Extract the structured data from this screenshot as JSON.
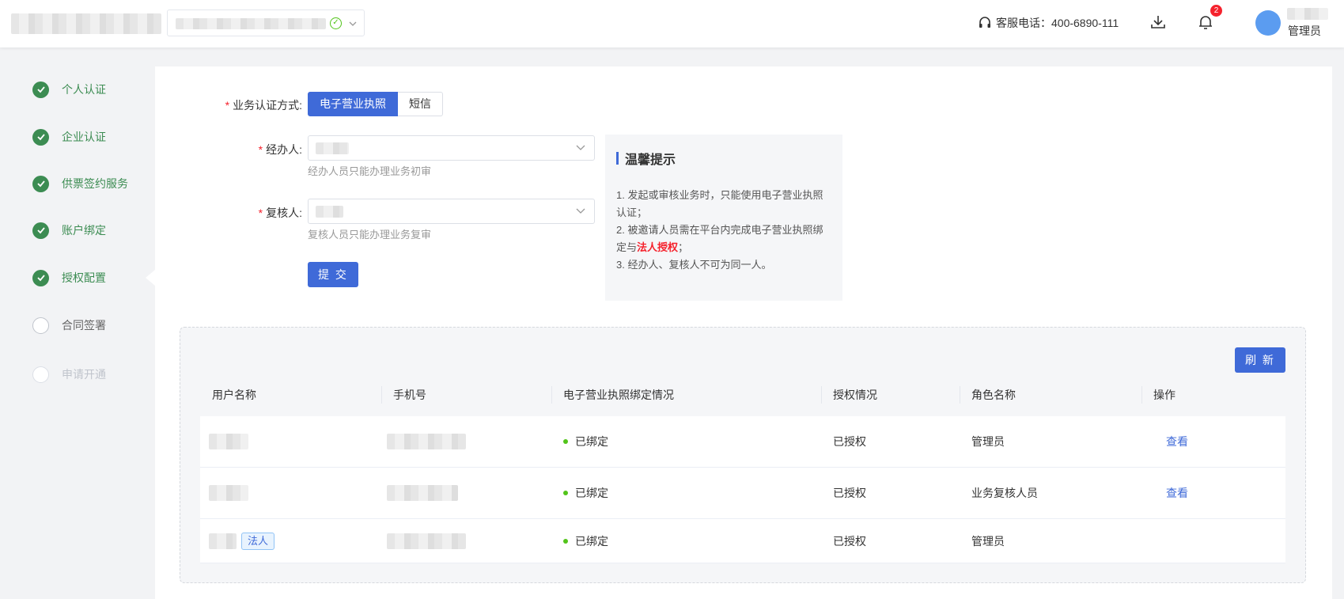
{
  "header": {
    "hotline_label": "客服电话：400-6890-111",
    "notification_count": "2",
    "user_role": "管理员"
  },
  "steps": [
    {
      "label": "个人认证",
      "state": "done"
    },
    {
      "label": "企业认证",
      "state": "done"
    },
    {
      "label": "供票签约服务",
      "state": "done"
    },
    {
      "label": "账户绑定",
      "state": "done"
    },
    {
      "label": "授权配置",
      "state": "done"
    },
    {
      "label": "合同签署",
      "state": "todo"
    },
    {
      "label": "申请开通",
      "state": "disabled"
    }
  ],
  "form": {
    "auth_method_label": "业务认证方式:",
    "auth_options": [
      "电子营业执照",
      "短信"
    ],
    "handler_label": "经办人:",
    "handler_hint": "经办人员只能办理业务初审",
    "reviewer_label": "复核人:",
    "reviewer_hint": "复核人员只能办理业务复审",
    "submit_label": "提 交"
  },
  "tips": {
    "title": "温馨提示",
    "item1": "1. 发起或审核业务时，只能使用电子营业执照认证；",
    "item2_pre": "2. 被邀请人员需在平台内完成电子营业执照绑定与",
    "item2_em": "法人授权",
    "item2_post": "；",
    "item3": "3. 经办人、复核人不可为同一人。"
  },
  "table": {
    "refresh_label": "刷 新",
    "columns": [
      "用户名称",
      "手机号",
      "电子营业执照绑定情况",
      "授权情况",
      "角色名称",
      "操作"
    ],
    "rows": [
      {
        "binding": "已绑定",
        "auth": "已授权",
        "role": "管理员",
        "action": "查看"
      },
      {
        "binding": "已绑定",
        "auth": "已授权",
        "role": "业务复核人员",
        "action": "查看"
      },
      {
        "binding": "已绑定",
        "auth": "已授权",
        "role": "管理员",
        "action": "",
        "tag": "法人"
      }
    ]
  },
  "colors": {
    "primary": "#3f6ad8",
    "step_done": "#3c8c52",
    "danger": "#f5222d",
    "success": "#52c41a"
  }
}
